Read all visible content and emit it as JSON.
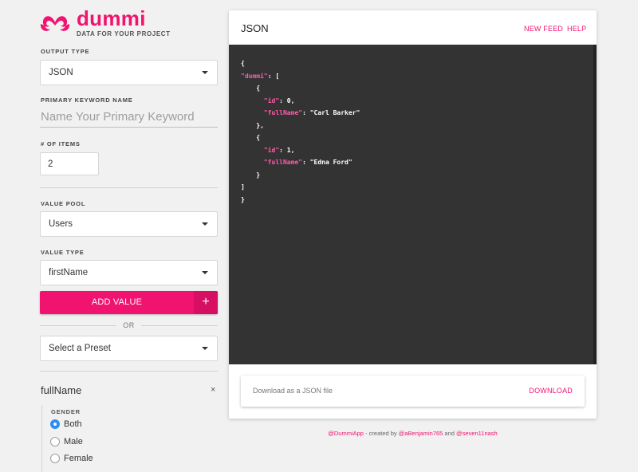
{
  "brand": {
    "title": "dummi",
    "subtitle": "DATA FOR YOUR PROJECT",
    "accent": "#f0136f"
  },
  "sidebar": {
    "output_type": {
      "label": "OUTPUT TYPE",
      "value": "JSON"
    },
    "primary_keyword": {
      "label": "PRIMARY KEYWORD NAME",
      "placeholder": "Name Your Primary Keyword",
      "value": ""
    },
    "num_items": {
      "label": "# OF ITEMS",
      "value": "2"
    },
    "value_pool": {
      "label": "VALUE POOL",
      "value": "Users"
    },
    "value_type": {
      "label": "VALUE TYPE",
      "value": "firstName"
    },
    "add_value": {
      "label": "ADD VALUE",
      "icon": "plus-icon",
      "icon_glyph": "+"
    },
    "or_text": "OR",
    "preset": {
      "value": "Select a Preset"
    },
    "value_item": {
      "name": "fullName",
      "remove_glyph": "×",
      "gender_label": "GENDER",
      "options": [
        {
          "label": "Both",
          "checked": true
        },
        {
          "label": "Male",
          "checked": false
        },
        {
          "label": "Female",
          "checked": false
        }
      ]
    }
  },
  "panel": {
    "title": "JSON",
    "links": {
      "new_feed": "NEW FEED",
      "help": "HELP"
    },
    "code": {
      "open_brace": "{",
      "root_key": "\"dummi\"",
      "root_sep": ": [",
      "items": [
        {
          "id_key": "\"id\"",
          "id_val": ": 0,",
          "name_key": "\"fullName\"",
          "name_val": ": \"Carl Barker\"",
          "close": "},"
        },
        {
          "id_key": "\"id\"",
          "id_val": ": 1,",
          "name_key": "\"fullName\"",
          "name_val": ": \"Edna Ford\"",
          "close": "}"
        }
      ],
      "item_open": "{",
      "close_array": "]",
      "close_brace": "}"
    },
    "download": {
      "text": "Download as a JSON file",
      "button": "DOWNLOAD"
    }
  },
  "footer": {
    "app_handle": "@DummiApp",
    "created_by": " - created by ",
    "author1": "@aBenjamin765",
    "and": " and ",
    "author2": "@seven11nash"
  }
}
